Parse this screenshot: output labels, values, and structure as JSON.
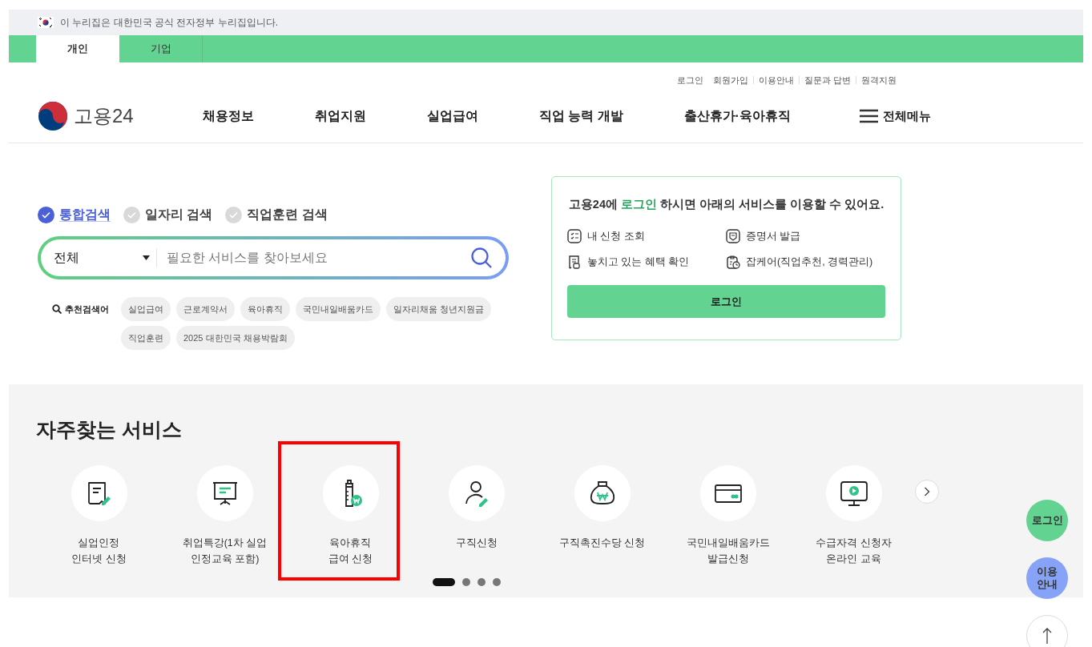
{
  "gov_banner": {
    "text": "이 누리집은 대한민국 공식 전자정부 누리집입니다."
  },
  "audience_tabs": [
    {
      "label": "개인",
      "selected": true
    },
    {
      "label": "기업",
      "selected": false
    }
  ],
  "utility_links": [
    "로그인",
    "회원가입",
    "이용안내",
    "질문과 답변",
    "원격지원"
  ],
  "logo": {
    "text": "고용24"
  },
  "nav": [
    "채용정보",
    "취업지원",
    "실업급여",
    "직업 능력 개발",
    "출산휴가·육아휴직"
  ],
  "all_menu": "전체메뉴",
  "search": {
    "scopes": [
      {
        "label": "통합검색",
        "selected": true
      },
      {
        "label": "일자리 검색",
        "selected": false
      },
      {
        "label": "직업훈련 검색",
        "selected": false
      }
    ],
    "category": "전체",
    "placeholder": "필요한 서비스를 찾아보세요",
    "recommended_label": "추천검색어",
    "recommended": [
      "실업급여",
      "근로계약서",
      "육아휴직",
      "국민내일배움카드",
      "일자리채움 청년지원금",
      "직업훈련",
      "2025 대한민국 채용박람회"
    ]
  },
  "login_card": {
    "message": "고용24에 **로그인** 하시면 아래의 서비스를 이용할 수 있어요.",
    "features": [
      {
        "label": "내 신청 조회",
        "kind": "list"
      },
      {
        "label": "증명서 발급",
        "kind": "certificate"
      },
      {
        "label": "놓치고 있는 혜택 확인",
        "kind": "benefit"
      },
      {
        "label": "잡케어(직업추천, 경력관리)",
        "kind": "career"
      }
    ],
    "button": "로그인"
  },
  "services": {
    "title": "자주찾는 서비스",
    "items": [
      {
        "label": "실업인정\n인터넷 신청",
        "kind": "document",
        "highlighted": false
      },
      {
        "label": "취업특강(1차 실업\n인정교육 포함)",
        "kind": "board",
        "highlighted": false
      },
      {
        "label": "육아휴직\n급여 신청",
        "kind": "bottle",
        "highlighted": true
      },
      {
        "label": "구직신청",
        "kind": "person",
        "highlighted": false
      },
      {
        "label": "구직촉진수당 신청",
        "kind": "moneybag",
        "highlighted": false
      },
      {
        "label": "국민내일배움카드\n발급신청",
        "kind": "card",
        "highlighted": false
      },
      {
        "label": "수급자격 신청자\n온라인 교육",
        "kind": "monitor",
        "highlighted": false
      }
    ],
    "pages": [
      {
        "selected": true
      },
      {
        "selected": false
      },
      {
        "selected": false
      },
      {
        "selected": false
      }
    ]
  },
  "floating": [
    {
      "label": "로그인",
      "kind": "login"
    },
    {
      "label": "이용\n안내",
      "kind": "guide"
    },
    {
      "kind": "top"
    }
  ]
}
